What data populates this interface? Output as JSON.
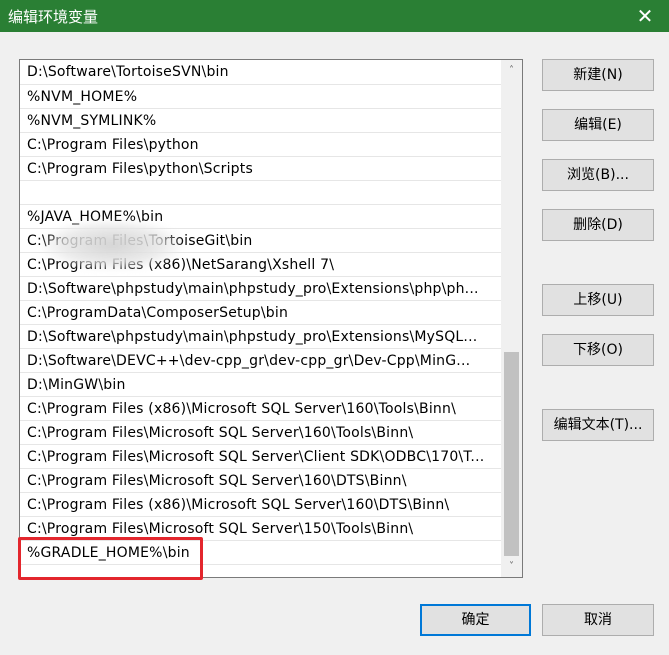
{
  "window": {
    "title": "编辑环境变量",
    "close_glyph": "✕"
  },
  "paths": [
    "D:\\Software\\TortoiseSVN\\bin",
    "%NVM_HOME%",
    "%NVM_SYMLINK%",
    "C:\\Program Files\\python",
    "C:\\Program Files\\python\\Scripts",
    "",
    "%JAVA_HOME%\\bin",
    "C:\\Program Files\\TortoiseGit\\bin",
    "C:\\Program Files (x86)\\NetSarang\\Xshell 7\\",
    "D:\\Software\\phpstudy\\main\\phpstudy_pro\\Extensions\\php\\ph...",
    "C:\\ProgramData\\ComposerSetup\\bin",
    "D:\\Software\\phpstudy\\main\\phpstudy_pro\\Extensions\\MySQL...",
    "D:\\Software\\DEVC++\\dev-cpp_gr\\dev-cpp_gr\\Dev-Cpp\\MinG...",
    "D:\\MinGW\\bin",
    "C:\\Program Files (x86)\\Microsoft SQL Server\\160\\Tools\\Binn\\",
    "C:\\Program Files\\Microsoft SQL Server\\160\\Tools\\Binn\\",
    "C:\\Program Files\\Microsoft SQL Server\\Client SDK\\ODBC\\170\\T...",
    "C:\\Program Files\\Microsoft SQL Server\\160\\DTS\\Binn\\",
    "C:\\Program Files (x86)\\Microsoft SQL Server\\160\\DTS\\Binn\\",
    "C:\\Program Files\\Microsoft SQL Server\\150\\Tools\\Binn\\",
    "%GRADLE_HOME%\\bin"
  ],
  "buttons": {
    "new": "新建(N)",
    "edit": "编辑(E)",
    "browse": "浏览(B)...",
    "delete": "删除(D)",
    "move_up": "上移(U)",
    "move_down": "下移(O)",
    "edit_text": "编辑文本(T)...",
    "ok": "确定",
    "cancel": "取消"
  },
  "scrollbar": {
    "up_glyph": "˄",
    "down_glyph": "˅"
  },
  "colors": {
    "titlebar": "#2a7f34",
    "highlight": "#e3262d",
    "default_button_border": "#0078d7"
  }
}
